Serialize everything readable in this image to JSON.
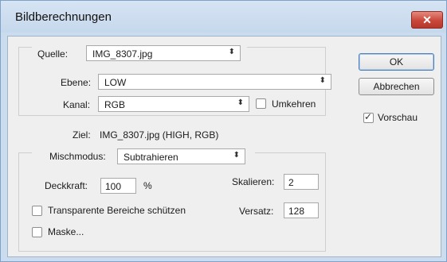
{
  "window": {
    "title": "Bildberechnungen",
    "close_glyph": "✕"
  },
  "source": {
    "label": "Quelle:",
    "value": "IMG_8307.jpg",
    "layer_label": "Ebene:",
    "layer_value": "LOW",
    "channel_label": "Kanal:",
    "channel_value": "RGB",
    "invert_label": "Umkehren",
    "invert_checked": false
  },
  "target": {
    "label": "Ziel:",
    "value": "IMG_8307.jpg (HIGH, RGB)"
  },
  "blending": {
    "label": "Mischmodus:",
    "value": "Subtrahieren",
    "opacity_label": "Deckkraft:",
    "opacity_value": "100",
    "opacity_unit": "%",
    "scale_label": "Skalieren:",
    "scale_value": "2",
    "offset_label": "Versatz:",
    "offset_value": "128",
    "preserve_transparency_label": "Transparente Bereiche schützen",
    "preserve_transparency_checked": false,
    "mask_label": "Maske...",
    "mask_checked": false
  },
  "buttons": {
    "ok": "OK",
    "cancel": "Abbrechen"
  },
  "preview": {
    "label": "Vorschau",
    "checked": true,
    "check_glyph": "✓"
  },
  "icons": {
    "dropdown_arrow": "⬍"
  }
}
